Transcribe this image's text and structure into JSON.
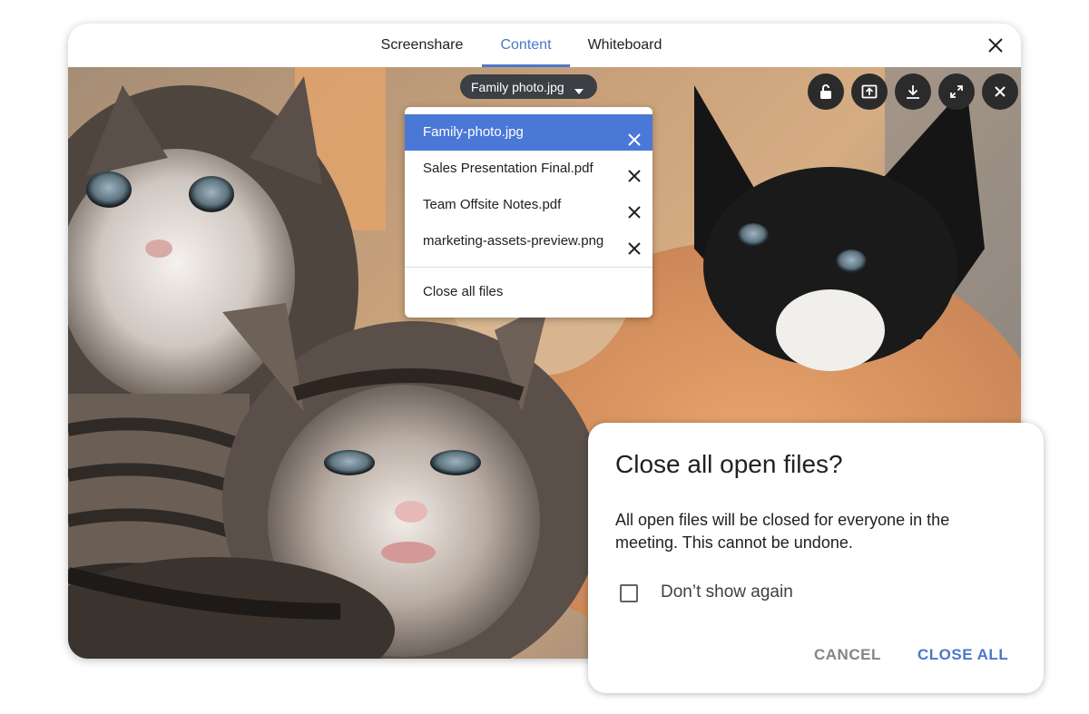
{
  "tabs": [
    {
      "label": "Screenshare",
      "active": false
    },
    {
      "label": "Content",
      "active": true
    },
    {
      "label": "Whiteboard",
      "active": false
    }
  ],
  "viewer": {
    "current_file": "Family photo.jpg",
    "photo_subject": "",
    "controls": [
      {
        "name": "unlock-icon",
        "label": ""
      },
      {
        "name": "present-upload-icon",
        "label": ""
      },
      {
        "name": "download-icon",
        "label": ""
      },
      {
        "name": "fullscreen-icon",
        "label": ""
      },
      {
        "name": "close-icon",
        "label": ""
      }
    ]
  },
  "file_menu": {
    "items": [
      {
        "label": "Family-photo.jpg",
        "selected": true
      },
      {
        "label": "Sales Presentation Final.pdf",
        "selected": false
      },
      {
        "label": "Team Offsite Notes.pdf",
        "selected": false
      },
      {
        "label": "marketing-assets-preview.png",
        "selected": false
      }
    ],
    "close_all_label": "Close all files"
  },
  "dialog": {
    "title": "Close all open files?",
    "body": "All open files will be closed for everyone in the meeting. This cannot be undone.",
    "checkbox_label": "Don’t show again",
    "checkbox_checked": false,
    "cancel_label": "CANCEL",
    "confirm_label": "CLOSE ALL"
  },
  "colors": {
    "accent": "#4a78c8",
    "selected_row": "#4a78d6",
    "chip_bg": "#3c3f43",
    "control_bg": "#2b2b2b"
  }
}
